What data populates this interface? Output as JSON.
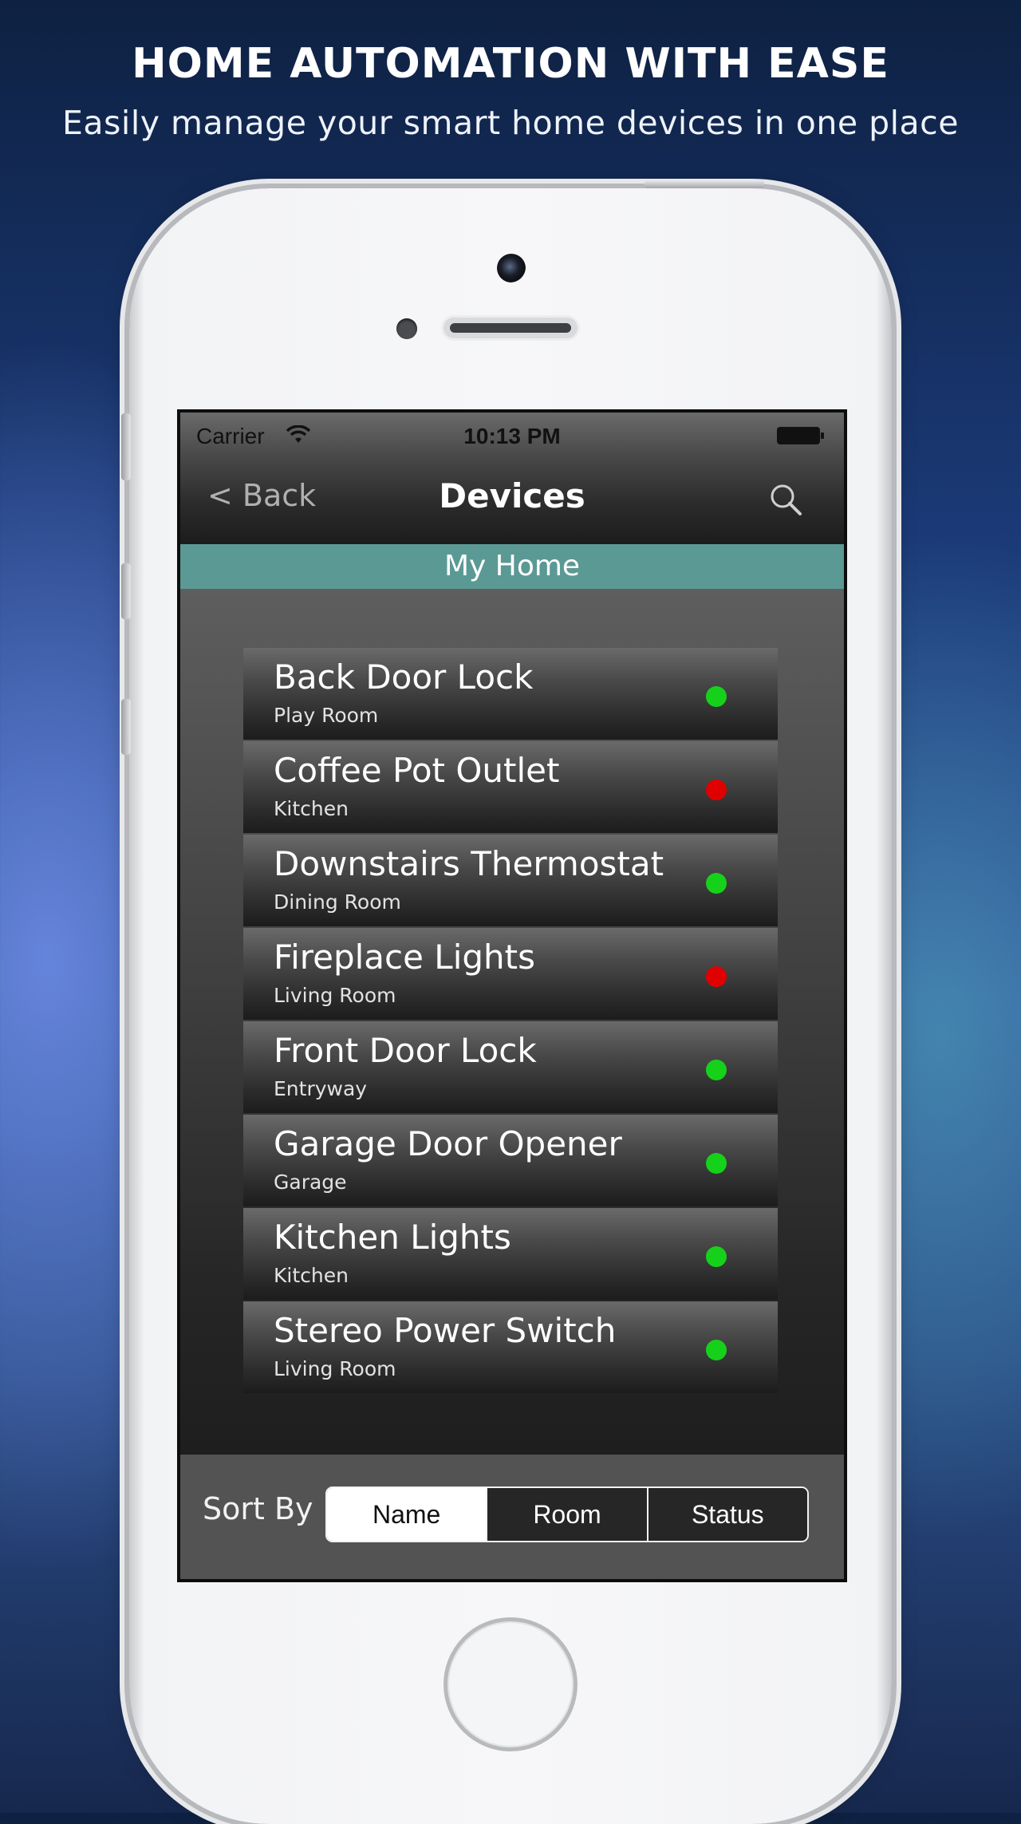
{
  "promo": {
    "headline": "HOME AUTOMATION WITH EASE",
    "subheadline": "Easily manage your smart home devices in one place"
  },
  "status_bar": {
    "carrier": "Carrier",
    "time": "10:13 PM"
  },
  "nav": {
    "back_label": "< Back",
    "title": "Devices",
    "search_icon": "search-icon"
  },
  "location": "My Home",
  "devices": [
    {
      "name": "Back Door Lock",
      "room": "Play Room",
      "status": "on"
    },
    {
      "name": "Coffee Pot Outlet",
      "room": "Kitchen",
      "status": "off"
    },
    {
      "name": "Downstairs Thermostat",
      "room": "Dining Room",
      "status": "on"
    },
    {
      "name": "Fireplace Lights",
      "room": "Living Room",
      "status": "off"
    },
    {
      "name": "Front Door Lock",
      "room": "Entryway",
      "status": "on"
    },
    {
      "name": "Garage Door Opener",
      "room": "Garage",
      "status": "on"
    },
    {
      "name": "Kitchen Lights",
      "room": "Kitchen",
      "status": "on"
    },
    {
      "name": "Stereo Power Switch",
      "room": "Living Room",
      "status": "on"
    }
  ],
  "status_colors": {
    "on": "#16d11a",
    "off": "#e00000"
  },
  "sort": {
    "label": "Sort By",
    "options": [
      "Name",
      "Room",
      "Status"
    ],
    "selected": "Name"
  },
  "colors": {
    "banner": "#5b9994"
  }
}
